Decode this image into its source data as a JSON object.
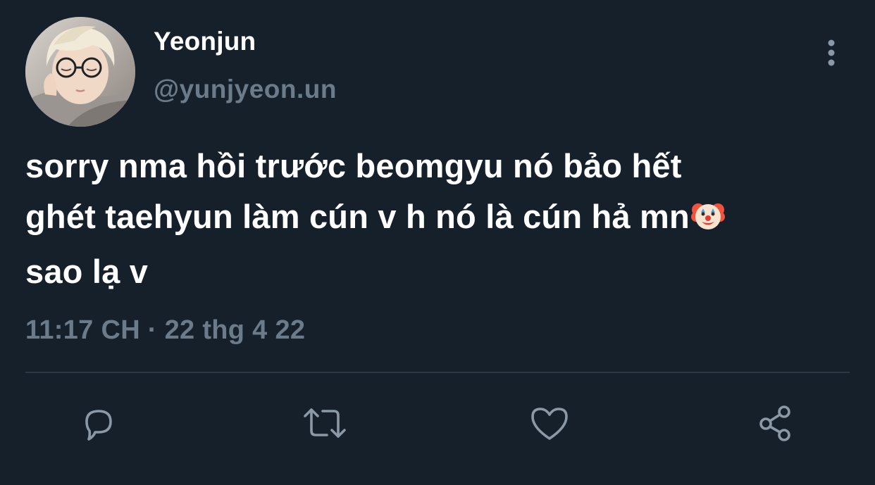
{
  "tweet": {
    "display_name": "Yeonjun",
    "handle": "@yunjyeon.un",
    "text_lines": [
      "sorry nma hồi trước beomgyu nó bảo hết",
      "ghét taehyun làm cún v h nó là cún hả mn",
      "sao lạ v"
    ],
    "emoji": "clown-face",
    "timestamp": "11:17 CH · 22 thg 4 22"
  },
  "actions": [
    {
      "name": "reply",
      "icon": "reply-icon"
    },
    {
      "name": "retweet",
      "icon": "retweet-icon"
    },
    {
      "name": "like",
      "icon": "heart-icon"
    },
    {
      "name": "share",
      "icon": "share-icon"
    }
  ],
  "colors": {
    "background": "#15202b",
    "primary_text": "#ffffff",
    "secondary_text": "#6c7b8a",
    "icon": "#8b98a5",
    "divider": "#2b3947"
  }
}
